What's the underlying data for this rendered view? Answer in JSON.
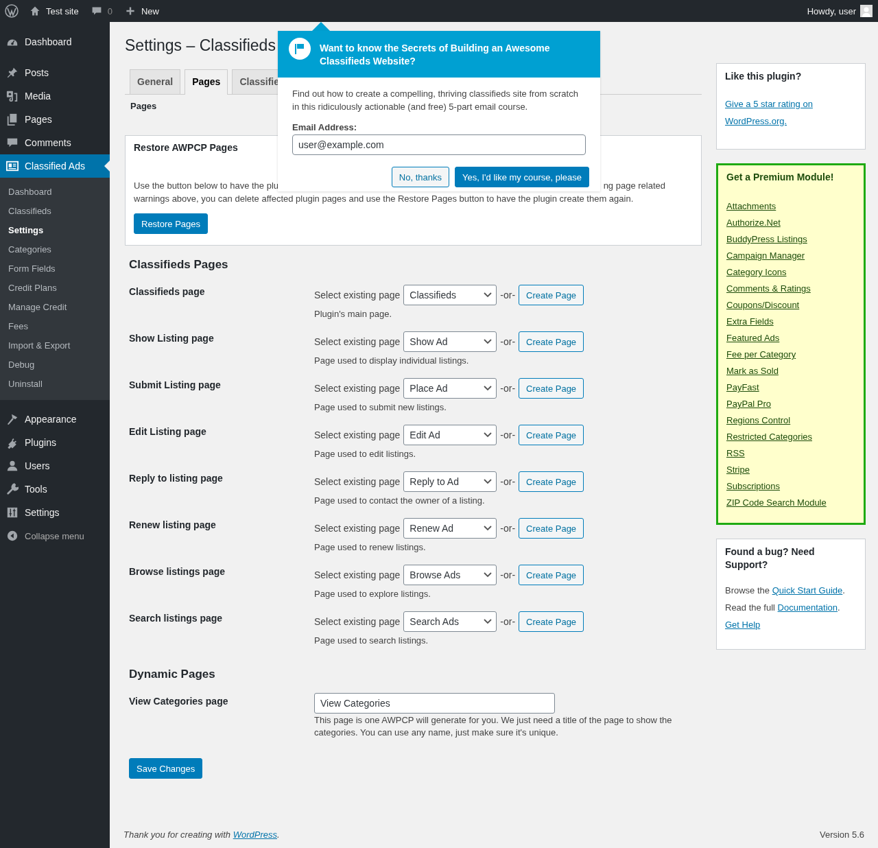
{
  "admin_bar": {
    "site": "Test site",
    "comments": "0",
    "new": "New",
    "greeting": "Howdy, user"
  },
  "menu": [
    {
      "label": "Dashboard",
      "selected": false
    },
    {
      "label": "Posts",
      "selected": false
    },
    {
      "label": "Media",
      "selected": false
    },
    {
      "label": "Pages",
      "selected": false
    },
    {
      "label": "Comments",
      "selected": false
    },
    {
      "label": "Classified Ads",
      "selected": true,
      "submenu": [
        {
          "label": "Dashboard",
          "selected": false
        },
        {
          "label": "Classifieds",
          "selected": false
        },
        {
          "label": "Settings",
          "selected": true
        },
        {
          "label": "Categories",
          "selected": false
        },
        {
          "label": "Form Fields",
          "selected": false
        },
        {
          "label": "Credit Plans",
          "selected": false
        },
        {
          "label": "Manage Credit",
          "selected": false
        },
        {
          "label": "Fees",
          "selected": false
        },
        {
          "label": "Import & Export",
          "selected": false
        },
        {
          "label": "Debug",
          "selected": false
        },
        {
          "label": "Uninstall",
          "selected": false
        }
      ]
    },
    {
      "label": "Appearance",
      "selected": false
    },
    {
      "label": "Plugins",
      "selected": false
    },
    {
      "label": "Users",
      "selected": false
    },
    {
      "label": "Tools",
      "selected": false
    },
    {
      "label": "Settings",
      "selected": false
    }
  ],
  "collapse": "Collapse menu",
  "page_title": "Settings – Classifieds",
  "tabs": [
    {
      "label": "General",
      "selected": false
    },
    {
      "label": "Pages",
      "selected": true
    },
    {
      "label": "Classifie",
      "selected": false
    }
  ],
  "subnav": "Pages",
  "restore": {
    "title": "Restore AWPCP Pages",
    "text_start": "Use the button below to have the plu",
    "text_end": "ng page related",
    "text_line2": "warnings above, you can delete affected plugin pages and use the Restore Pages button to have the plugin create them again.",
    "button": "Restore Pages"
  },
  "sections": [
    {
      "heading": "Classifieds Pages",
      "rows": [
        {
          "kind": "select",
          "label": "Classifieds page",
          "prefix": "Select existing page",
          "value": "Classifieds",
          "or": "-or-",
          "button": "Create Page",
          "hint": "Plugin's main page."
        },
        {
          "kind": "select",
          "label": "Show Listing page",
          "prefix": "Select existing page",
          "value": "Show Ad",
          "or": "-or-",
          "button": "Create Page",
          "hint": "Page used to display individual listings."
        },
        {
          "kind": "select",
          "label": "Submit Listing page",
          "prefix": "Select existing page",
          "value": "Place Ad",
          "or": "-or-",
          "button": "Create Page",
          "hint": "Page used to submit new listings."
        },
        {
          "kind": "select",
          "label": "Edit Listing page",
          "prefix": "Select existing page",
          "value": "Edit Ad",
          "or": "-or-",
          "button": "Create Page",
          "hint": "Page used to edit listings."
        },
        {
          "kind": "select",
          "label": "Reply to listing page",
          "prefix": "Select existing page",
          "value": "Reply to Ad",
          "or": "-or-",
          "button": "Create Page",
          "hint": "Page used to contact the owner of a listing."
        },
        {
          "kind": "select",
          "label": "Renew listing page",
          "prefix": "Select existing page",
          "value": "Renew Ad",
          "or": "-or-",
          "button": "Create Page",
          "hint": "Page used to renew listings."
        },
        {
          "kind": "select",
          "label": "Browse listings page",
          "prefix": "Select existing page",
          "value": "Browse Ads",
          "or": "-or-",
          "button": "Create Page",
          "hint": "Page used to explore listings."
        },
        {
          "kind": "select",
          "label": "Search listings page",
          "prefix": "Select existing page",
          "value": "Search Ads",
          "or": "-or-",
          "button": "Create Page",
          "hint": "Page used to search listings."
        }
      ]
    },
    {
      "heading": "Dynamic Pages",
      "rows": [
        {
          "kind": "text",
          "label": "View Categories page",
          "value": "View Categories",
          "hint": "This page is one AWPCP will generate for you. We just need a title of the page to show the categories. You can use any name, just make sure it's unique."
        }
      ]
    }
  ],
  "save_button": "Save Changes",
  "footer": {
    "text": "Thank you for creating with",
    "link": "WordPress",
    "end": ".",
    "version": "Version 5.6"
  },
  "popup": {
    "title": "Want to know the Secrets of Building an Awesome Classifieds Website?",
    "body": "Find out how to create a compelling, thriving classifieds site from scratch in this ridiculously actionable (and free) 5-part email course.",
    "email_label": "Email Address:",
    "email_value": "user@example.com",
    "decline": "No, thanks",
    "accept": "Yes, I'd like my course, please"
  },
  "like_box": {
    "title": "Like this plugin?",
    "link": "Give a 5 star rating on WordPress.org."
  },
  "premium_box": {
    "title": "Get a Premium Module!",
    "links": [
      "Attachments",
      "Authorize.Net",
      "BuddyPress Listings",
      "Campaign Manager",
      "Category Icons",
      "Comments & Ratings",
      "Coupons/Discount",
      "Extra Fields",
      "Featured Ads",
      "Fee per Category",
      "Mark as Sold",
      "PayFast",
      "PayPal Pro",
      "Regions Control",
      "Restricted Categories",
      "RSS",
      "Stripe",
      "Subscriptions",
      "ZIP Code Search Module"
    ]
  },
  "support_box": {
    "title": "Found a bug? Need Support?",
    "lines": [
      {
        "text": "Browse the ",
        "link": "Quick Start Guide",
        "end": "."
      },
      {
        "text": "Read the full ",
        "link": "Documentation",
        "end": "."
      },
      {
        "link": "Get Help"
      }
    ]
  }
}
